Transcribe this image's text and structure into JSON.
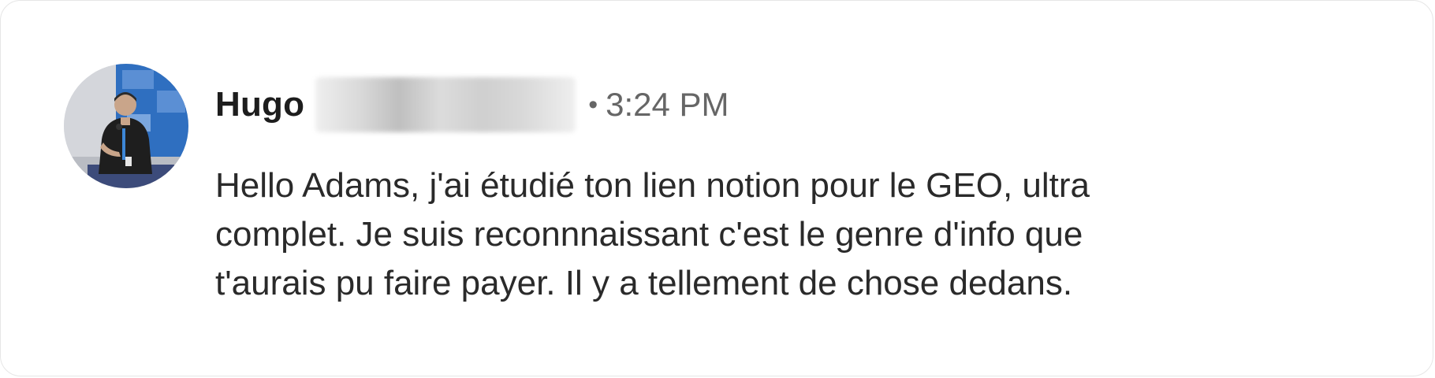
{
  "message": {
    "sender_name": "Hugo",
    "separator": "•",
    "timestamp": "3:24 PM",
    "avatar_icon": "profile-photo-speaker-on-stage",
    "body_lines": [
      "Hello Adams, j'ai étudié ton lien notion pour le GEO, ultra",
      "complet. Je suis reconnnaissant c'est le genre d'info que",
      "t'aurais pu faire payer. Il y a tellement de chose dedans."
    ]
  },
  "colors": {
    "name": "#1d1d1d",
    "meta": "#666666",
    "body": "#2a2a2a",
    "border": "#e6e6e6",
    "avatar_banner": "#2f6fc0"
  }
}
